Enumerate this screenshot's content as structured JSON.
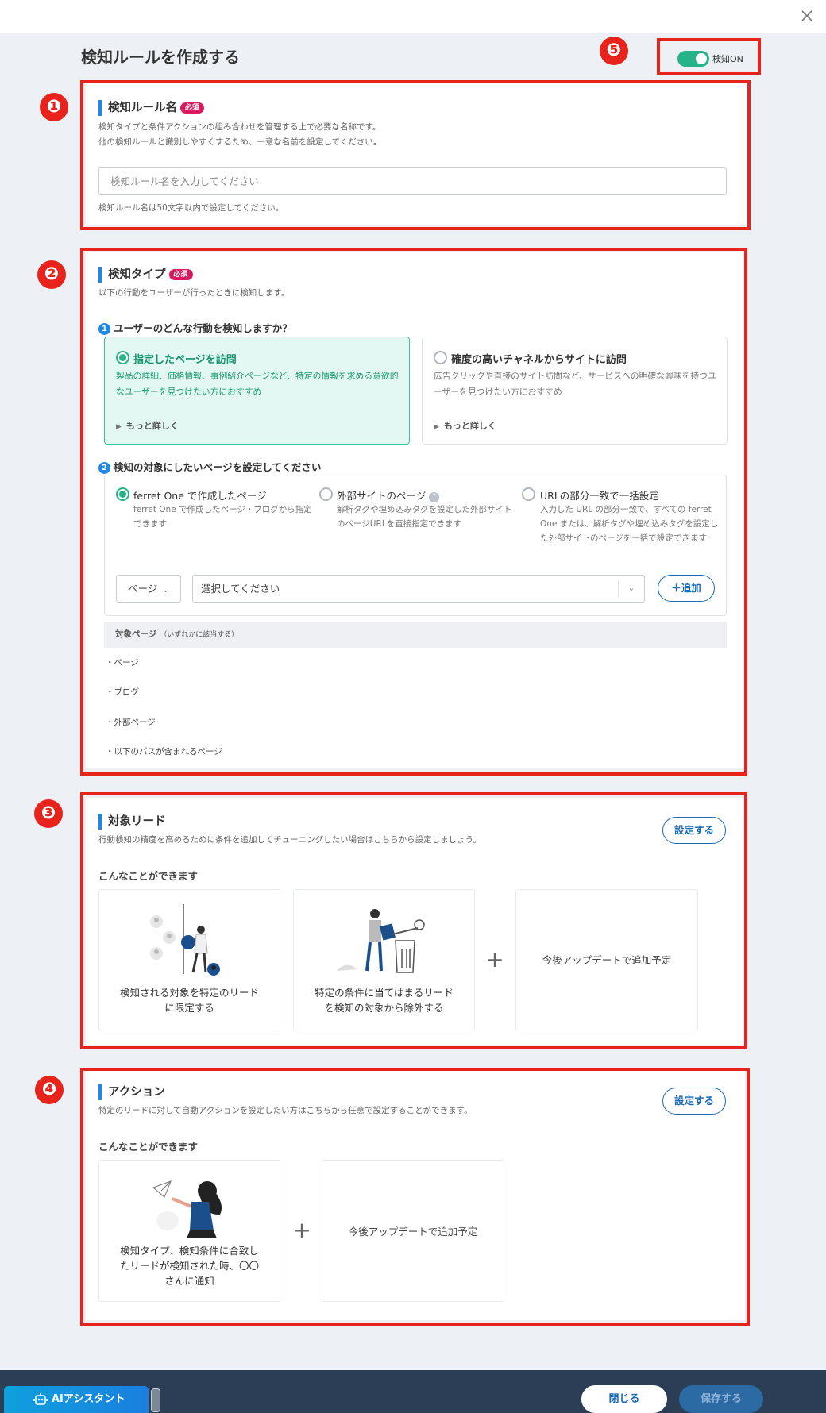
{
  "header": {
    "title": "検知ルールを作成する",
    "toggle_label": "検知ON",
    "toggle_on": true,
    "close_icon": "close-icon"
  },
  "markers": [
    "❶",
    "❷",
    "❸",
    "❹",
    "❺"
  ],
  "rule_name": {
    "title": "検知ルール名",
    "required": "必須",
    "desc1": "検知タイプと条件アクションの組み合わせを管理する上で必要な名称です。",
    "desc2": "他の検知ルールと識別しやすくするため、一意な名前を設定してください。",
    "placeholder": "検知ルール名を入力してください",
    "hint": "検知ルール名は50文字以内で設定してください。"
  },
  "detect_type": {
    "title": "検知タイプ",
    "required": "必須",
    "desc": "以下の行動をユーザーが行ったときに検知します。",
    "q1_num": "1",
    "q1": "ユーザーのどんな行動を検知しますか？",
    "opt1": {
      "title": "指定したページを訪問",
      "desc": "製品の詳細、価格情報、事例紹介ページなど、特定の情報を求める意欲的なユーザーを見つけたい方におすすめ",
      "more": "もっと詳しく"
    },
    "opt2": {
      "title": "確度の高いチャネルからサイトに訪問",
      "desc": "広告クリックや直接のサイト訪問など、サービスへの明確な興味を持つユーザーを見つけたい方におすすめ",
      "more": "もっと詳しく"
    },
    "q2_num": "2",
    "q2": "検知の対象にしたいページを設定してください",
    "r1": {
      "title": "ferret One で作成したページ",
      "desc": "ferret One で作成したページ・ブログから指定できます"
    },
    "r2": {
      "title": "外部サイトのページ",
      "help": "?",
      "desc": "解析タグや埋め込みタグを設定した外部サイトのページURLを直接指定できます"
    },
    "r3": {
      "title": "URLの部分一致で一括設定",
      "desc": "入力した URL の部分一致で、すべての ferret One または、解析タグや埋め込みタグを設定した外部サイトのページを一括で設定できます"
    },
    "page_select": "ページ",
    "select_placeholder": "選択してください",
    "add_label": "＋追加",
    "table_head": "対象ページ",
    "table_head_note": "（いずれかに該当する）",
    "list": [
      "・ページ",
      "・ブログ",
      "・外部ページ",
      "・以下のパスが含まれるページ"
    ]
  },
  "target_lead": {
    "title": "対象リード",
    "desc": "行動検知の精度を高めるために条件を追加してチューニングしたい場合はこちらから設定しましょう。",
    "set_label": "設定する",
    "can_do": "こんなことができます",
    "tiles": [
      {
        "line1": "検知される対象を特定のリード",
        "line2": "に限定する"
      },
      {
        "line1": "特定の条件に当てはまるリード",
        "line2": "を検知の対象から除外する"
      }
    ],
    "plus": "+",
    "future": "今後アップデートで追加予定"
  },
  "action": {
    "title": "アクション",
    "desc": "特定のリードに対して自動アクションを設定したい方はこちらから任意で設定することができます。",
    "set_label": "設定する",
    "can_do": "こんなことができます",
    "tile": {
      "line1": "検知タイプ、検知条件に合致し",
      "line2": "たリードが検知された時、〇〇",
      "line3": "さんに通知"
    },
    "plus": "+",
    "future": "今後アップデートで追加予定"
  },
  "footer": {
    "ai_label": "AIアシスタント",
    "close_label": "閉じる",
    "save_label": "保存する"
  },
  "colors": {
    "accent": "#1a69b3",
    "brand_green": "#26b389",
    "annotation_red": "#e8231b",
    "required_pink": "#d81b60"
  }
}
